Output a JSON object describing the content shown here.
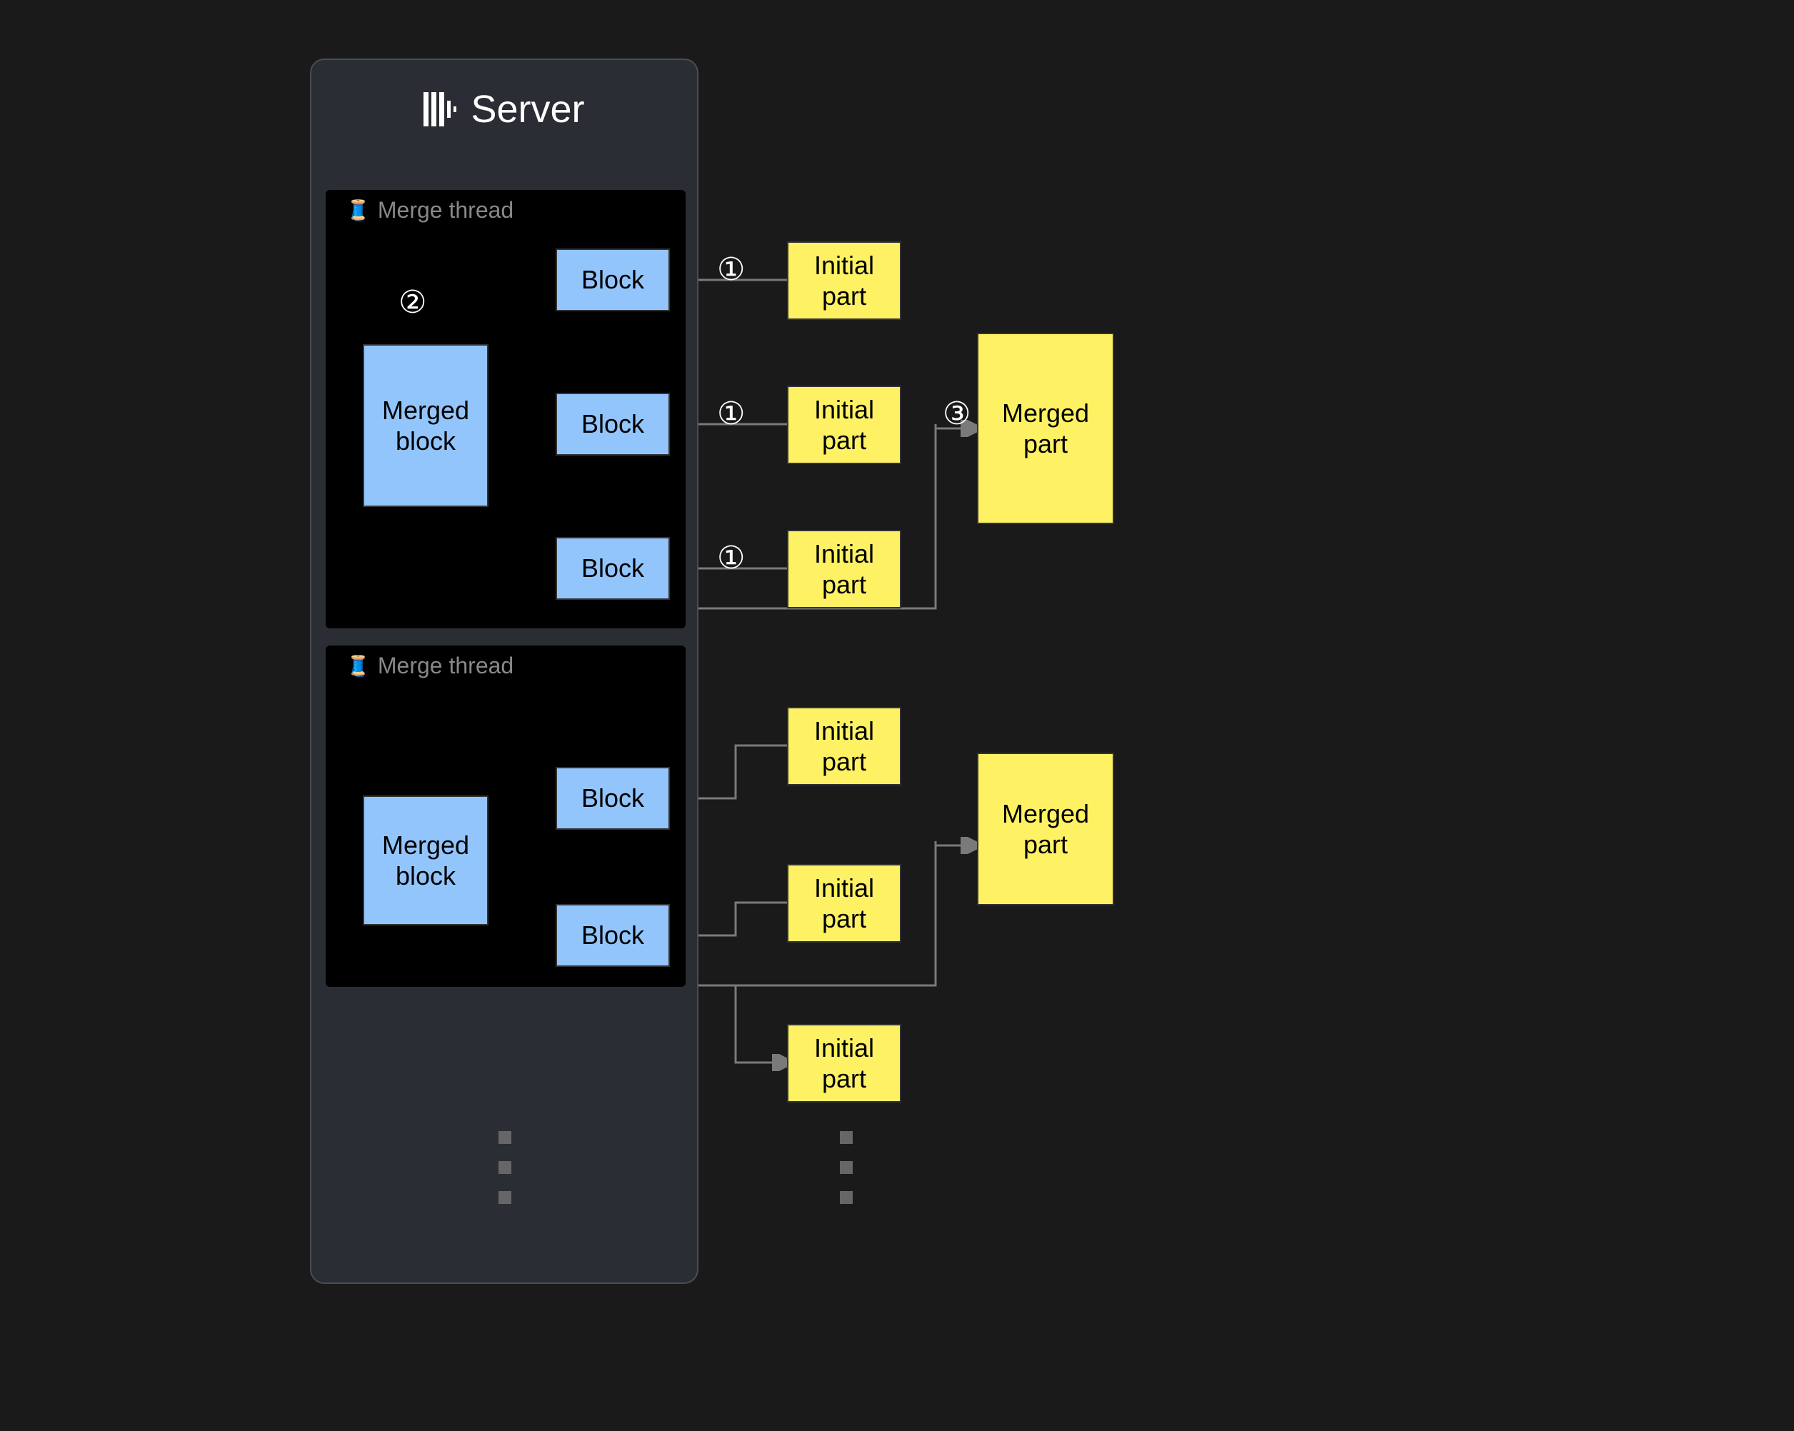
{
  "server": {
    "title": "Server"
  },
  "threads": [
    {
      "label": "Merge thread",
      "step_label": "②",
      "merged_block_label": "Merged\nblock",
      "blocks": [
        {
          "label": "Block",
          "step_label": "①",
          "initial_part_label": "Initial\npart"
        },
        {
          "label": "Block",
          "step_label": "①",
          "initial_part_label": "Initial\npart"
        },
        {
          "label": "Block",
          "step_label": "①",
          "initial_part_label": "Initial\npart"
        }
      ],
      "merged_part": {
        "label": "Merged\npart",
        "step_label": "③"
      }
    },
    {
      "label": "Merge thread",
      "merged_block_label": "Merged\nblock",
      "blocks": [
        {
          "label": "Block",
          "initial_part_label": "Initial\npart"
        },
        {
          "label": "Block",
          "initial_part_label": "Initial\npart"
        }
      ],
      "extra_initial_parts": [
        {
          "label": "Initial\npart"
        }
      ],
      "merged_part": {
        "label": "Merged\npart"
      }
    }
  ],
  "colors": {
    "block": "#93c5fd",
    "part": "#fef264",
    "bg": "#1a1a1a",
    "panel": "#2a2d33"
  }
}
